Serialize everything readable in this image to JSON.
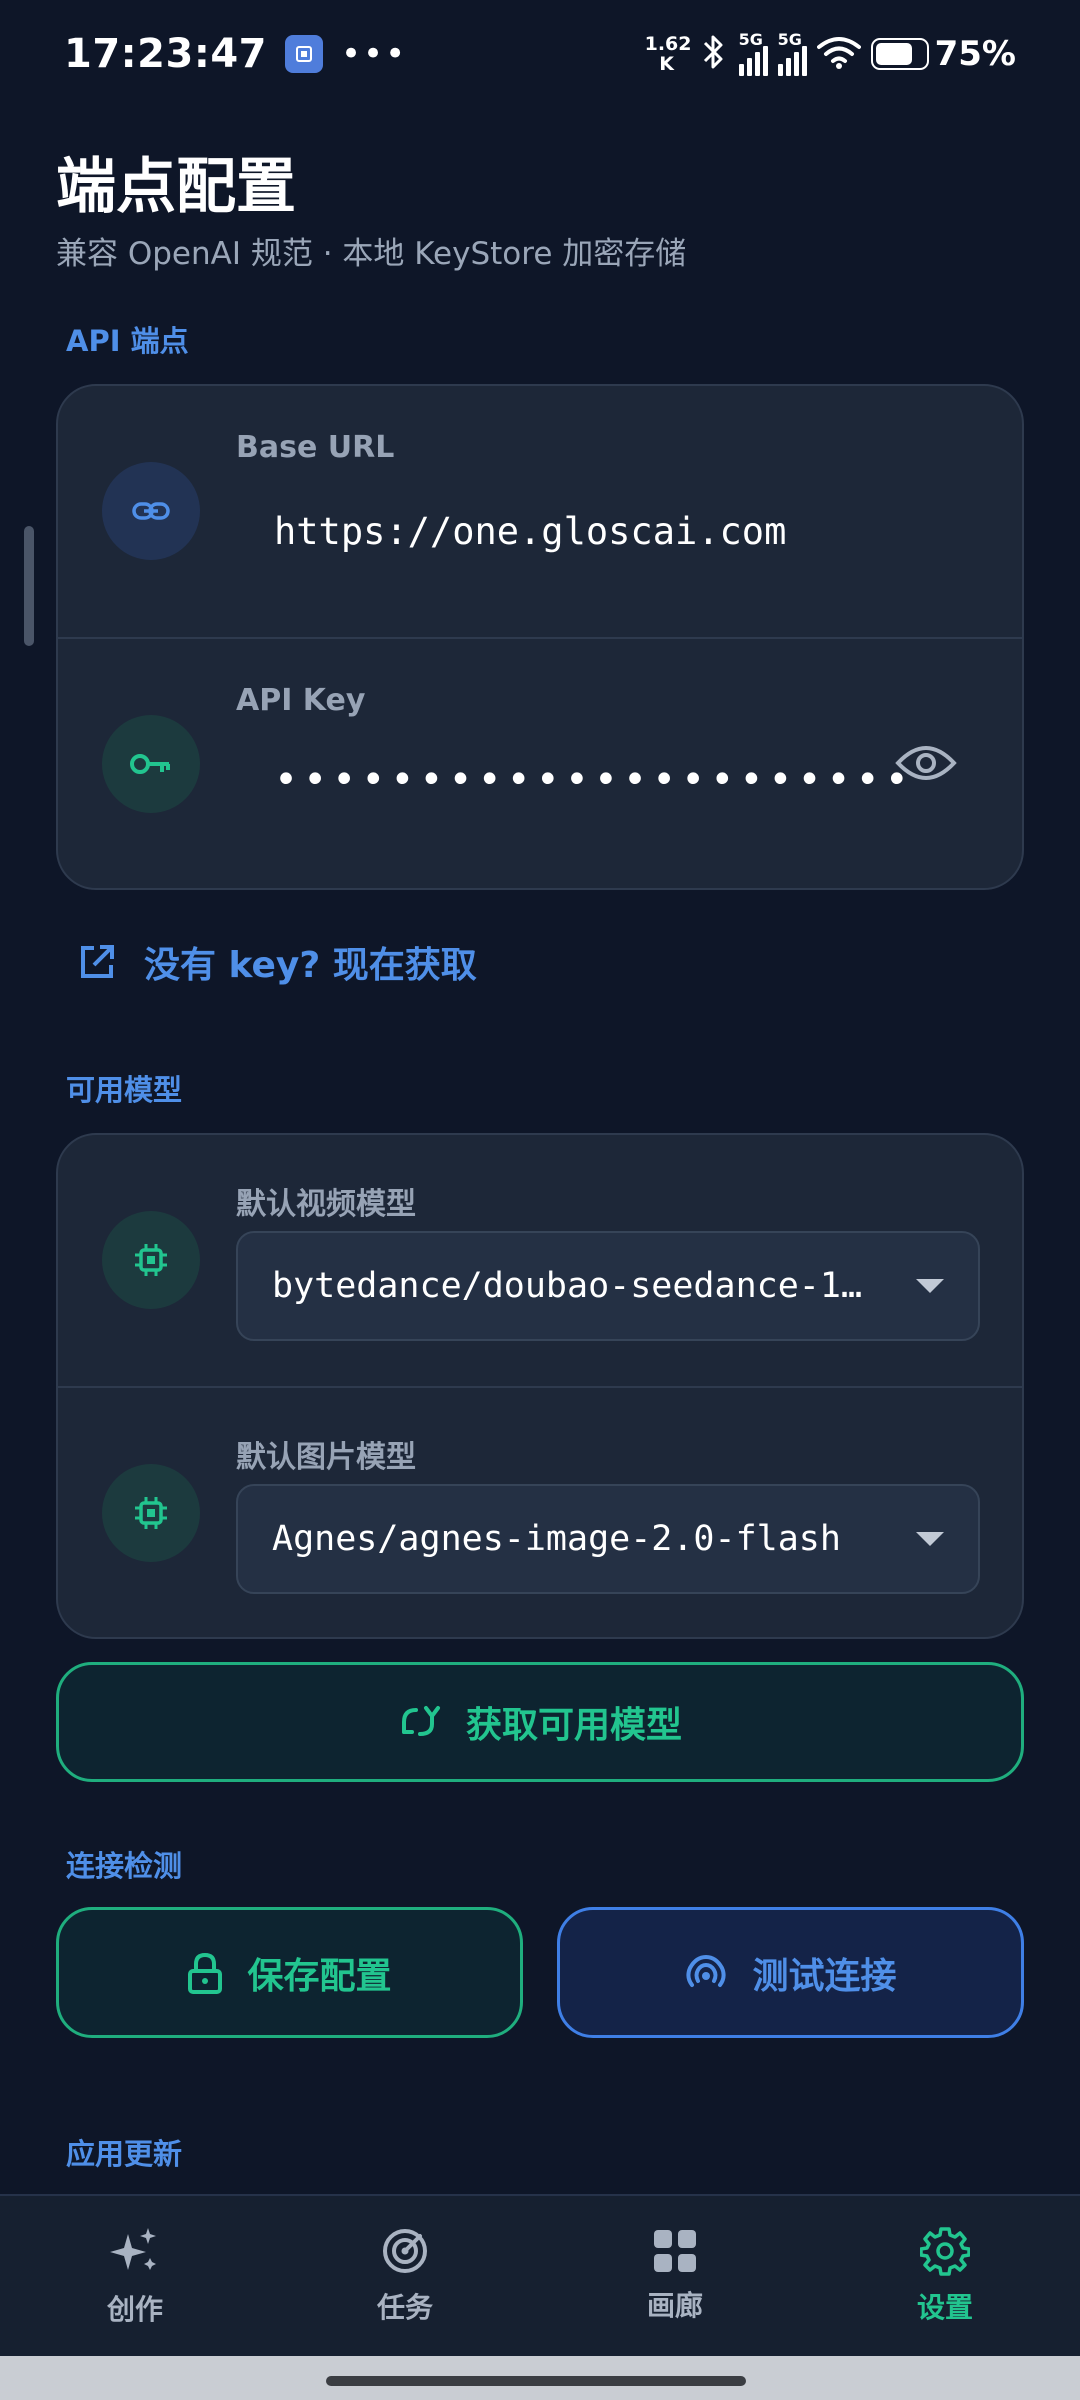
{
  "status_bar": {
    "time": "17:23:47",
    "more": "•••",
    "net_speed_value": "1.62",
    "net_speed_unit": "K",
    "sim1_label": "5G",
    "sim2_label": "5G",
    "battery_percent": "75%",
    "battery_level": 0.75
  },
  "header": {
    "title": "端点配置",
    "subtitle": "兼容 OpenAI 规范 · 本地 KeyStore 加密存储"
  },
  "api_section": {
    "label": "API 端点",
    "base_url": {
      "label": "Base URL",
      "value": "https://one.gloscai.com"
    },
    "api_key": {
      "label": "API Key",
      "value": "••••••••••••••••••••••"
    }
  },
  "get_key_link": "没有 key? 现在获取",
  "models_section": {
    "label": "可用模型",
    "video_model": {
      "label": "默认视频模型",
      "value": "bytedance/doubao-seedance-1…"
    },
    "image_model": {
      "label": "默认图片模型",
      "value": "Agnes/agnes-image-2.0-flash"
    }
  },
  "fetch_models_button": "获取可用模型",
  "connection_section": {
    "label": "连接检测",
    "save_button": "保存配置",
    "test_button": "测试连接"
  },
  "update_section": {
    "label": "应用更新"
  },
  "bottom_nav": {
    "items": [
      {
        "label": "创作",
        "icon": "sparkles-icon"
      },
      {
        "label": "任务",
        "icon": "radar-icon"
      },
      {
        "label": "画廊",
        "icon": "grid-icon"
      },
      {
        "label": "设置",
        "icon": "gear-icon",
        "active": true
      }
    ]
  },
  "colors": {
    "background": "#0e1628",
    "card": "#1d2738",
    "accent_blue": "#4f8fe8",
    "accent_green": "#22c58f"
  }
}
